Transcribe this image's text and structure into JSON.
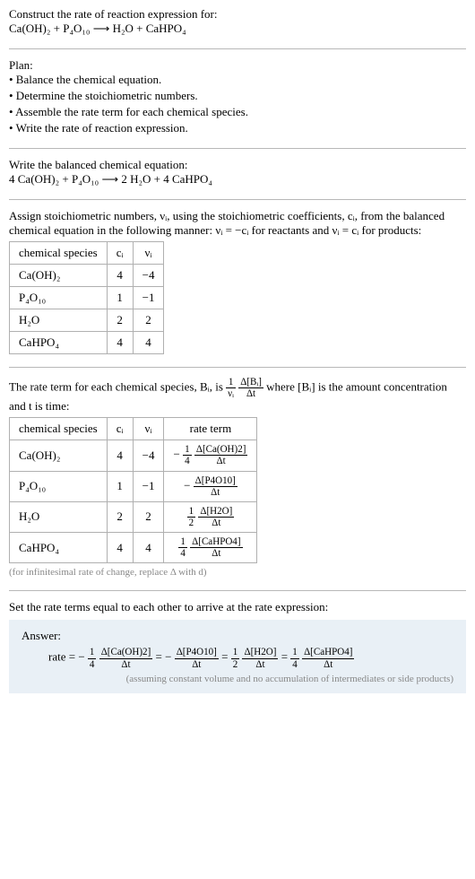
{
  "header": {
    "title": "Construct the rate of reaction expression for:",
    "equation": "Ca(OH)₂ + P₄O₁₀ ⟶ H₂O + CaHPO₄"
  },
  "plan": {
    "title": "Plan:",
    "items": [
      "• Balance the chemical equation.",
      "• Determine the stoichiometric numbers.",
      "• Assemble the rate term for each chemical species.",
      "• Write the rate of reaction expression."
    ]
  },
  "balanced": {
    "title": "Write the balanced chemical equation:",
    "equation": "4 Ca(OH)₂ + P₄O₁₀ ⟶ 2 H₂O + 4 CaHPO₄"
  },
  "stoich_intro": "Assign stoichiometric numbers, νᵢ, using the stoichiometric coefficients, cᵢ, from the balanced chemical equation in the following manner: νᵢ = −cᵢ for reactants and νᵢ = cᵢ for products:",
  "stoich_table": {
    "headers": [
      "chemical species",
      "cᵢ",
      "νᵢ"
    ],
    "rows": [
      {
        "species": "Ca(OH)₂",
        "c": "4",
        "v": "−4"
      },
      {
        "species": "P₄O₁₀",
        "c": "1",
        "v": "−1"
      },
      {
        "species": "H₂O",
        "c": "2",
        "v": "2"
      },
      {
        "species": "CaHPO₄",
        "c": "4",
        "v": "4"
      }
    ]
  },
  "rate_intro_1": "The rate term for each chemical species, Bᵢ, is ",
  "rate_intro_2": " where [Bᵢ] is the amount concentration and t is time:",
  "rate_frac": {
    "num_a": "1",
    "num_b": "νᵢ",
    "num_c": "Δ[Bᵢ]",
    "num_d": "Δt"
  },
  "rate_table": {
    "headers": [
      "chemical species",
      "cᵢ",
      "νᵢ",
      "rate term"
    ],
    "rows": [
      {
        "species": "Ca(OH)₂",
        "c": "4",
        "v": "−4",
        "sign": "−",
        "coef_num": "1",
        "coef_den": "4",
        "d_num": "Δ[Ca(OH)2]",
        "d_den": "Δt"
      },
      {
        "species": "P₄O₁₀",
        "c": "1",
        "v": "−1",
        "sign": "−",
        "coef_num": "",
        "coef_den": "",
        "d_num": "Δ[P4O10]",
        "d_den": "Δt"
      },
      {
        "species": "H₂O",
        "c": "2",
        "v": "2",
        "sign": "",
        "coef_num": "1",
        "coef_den": "2",
        "d_num": "Δ[H2O]",
        "d_den": "Δt"
      },
      {
        "species": "CaHPO₄",
        "c": "4",
        "v": "4",
        "sign": "",
        "coef_num": "1",
        "coef_den": "4",
        "d_num": "Δ[CaHPO4]",
        "d_den": "Δt"
      }
    ]
  },
  "footnote": "(for infinitesimal rate of change, replace Δ with d)",
  "set_equal": "Set the rate terms equal to each other to arrive at the rate expression:",
  "answer": {
    "label": "Answer:",
    "prefix": "rate = ",
    "terms": [
      {
        "sign": "−",
        "coef_num": "1",
        "coef_den": "4",
        "d_num": "Δ[Ca(OH)2]",
        "d_den": "Δt"
      },
      {
        "sign": "−",
        "coef_num": "",
        "coef_den": "",
        "d_num": "Δ[P4O10]",
        "d_den": "Δt"
      },
      {
        "sign": "",
        "coef_num": "1",
        "coef_den": "2",
        "d_num": "Δ[H2O]",
        "d_den": "Δt"
      },
      {
        "sign": "",
        "coef_num": "1",
        "coef_den": "4",
        "d_num": "Δ[CaHPO4]",
        "d_den": "Δt"
      }
    ],
    "note": "(assuming constant volume and no accumulation of intermediates or side products)"
  }
}
